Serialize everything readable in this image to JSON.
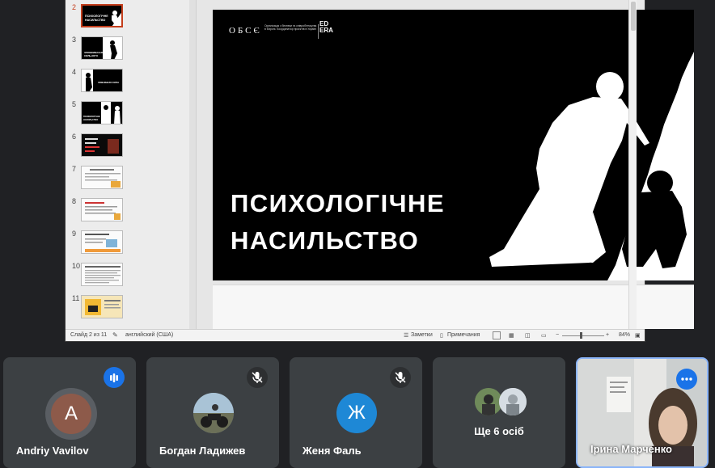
{
  "slides_panel": {
    "items": [
      {
        "num": "2",
        "active": true,
        "style": "dark",
        "caption": "ПСИХОЛОГІЧНЕ НАСИЛЬСТВО"
      },
      {
        "num": "3",
        "active": false,
        "style": "dark",
        "caption": "ЗЛОВЖИВАННЯ СИЛЬНОГО"
      },
      {
        "num": "4",
        "active": false,
        "style": "dark",
        "caption": "ЗОВНІШНЯ СИЛА"
      },
      {
        "num": "5",
        "active": false,
        "style": "dark",
        "caption": "ПСИХОЛОГІЧНЕ НАСИЛЬСТВО"
      },
      {
        "num": "6",
        "active": false,
        "style": "dark",
        "caption": ""
      },
      {
        "num": "7",
        "active": false,
        "style": "light",
        "caption": ""
      },
      {
        "num": "8",
        "active": false,
        "style": "light",
        "caption": ""
      },
      {
        "num": "9",
        "active": false,
        "style": "light",
        "caption": ""
      },
      {
        "num": "10",
        "active": false,
        "style": "light",
        "caption": ""
      },
      {
        "num": "11",
        "active": false,
        "style": "light",
        "caption": ""
      }
    ]
  },
  "slide": {
    "org_text": "ОБСЄ",
    "org_subtext": "Організація з безпеки та співробітництва в Європі. Координатор проєктів в Україні",
    "partner_logo": "ED ERA",
    "title_line1": "ПСИХОЛОГІЧНЕ",
    "title_line2": "НАСИЛЬСТВО"
  },
  "statusbar": {
    "slide_counter": "Слайд 2 из 11",
    "language": "английский (США)",
    "notes": "Заметки",
    "comments": "Примечания",
    "zoom": "84%"
  },
  "participants": [
    {
      "name": "Andriy Vavilov",
      "initial": "A",
      "avatar_color": "#8d5a4a",
      "state": "speaking"
    },
    {
      "name": "Богдан Ладижев",
      "initial": "",
      "avatar_color": "#6b7f8e",
      "state": "muted"
    },
    {
      "name": "Женя Фаль",
      "initial": "Ж",
      "avatar_color": "#1e88d6",
      "state": "muted"
    },
    {
      "name": "Ще 6 осіб",
      "initial": "",
      "avatar_color": "#5f6368",
      "state": "group"
    },
    {
      "name": "Ірина Марченко",
      "initial": "",
      "avatar_color": "#e8e8e8",
      "state": "video"
    }
  ],
  "colors": {
    "meet_bg": "#202124",
    "tile_bg": "#3c4043",
    "accent": "#1a73e8",
    "ppt_active": "#c43e1c"
  }
}
